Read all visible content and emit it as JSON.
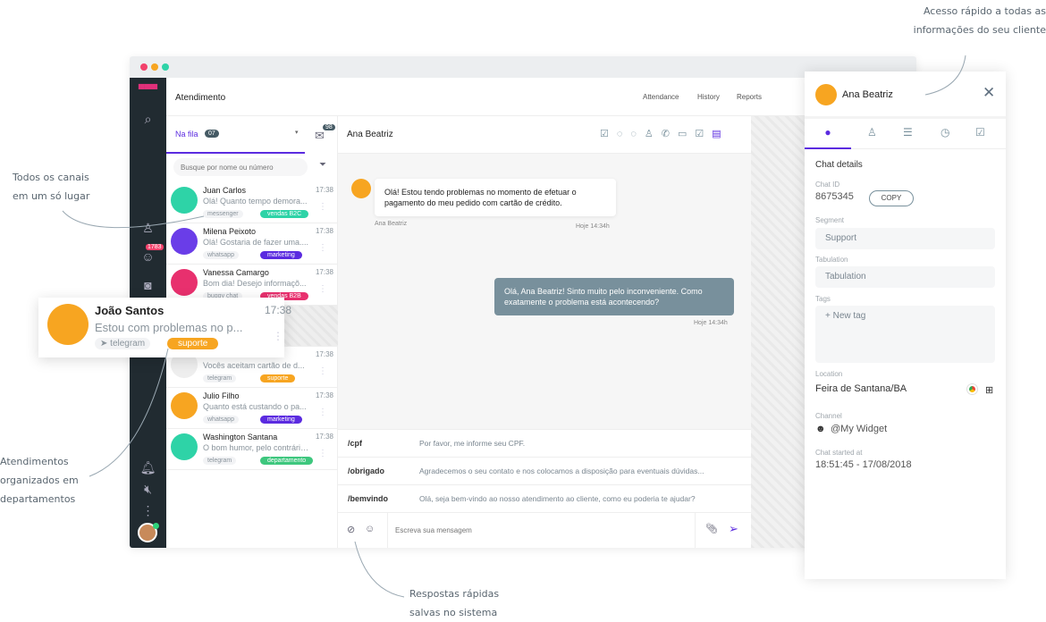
{
  "annotations": [
    "Acesso rápido a todas as informações do seu cliente",
    "Todos os canais em um só lugar",
    "Atendimentos organizados em departamentos",
    "Respostas rápidas salvas no sistema"
  ],
  "header": {
    "title": "Atendimento",
    "nav": [
      "Attendance",
      "History",
      "Reports"
    ]
  },
  "sidebar": {
    "badge": "1783"
  },
  "list": {
    "tab": "Na fila",
    "tab_count": "07",
    "inbox_count": "98",
    "search_placeholder": "Busque por nome ou número",
    "items": [
      {
        "name": "Juan Carlos",
        "msg": "Olá! Quanto tempo demora...",
        "time": "17:38",
        "channel": "messenger",
        "tag": "vendas B2C",
        "tag_color": "#2ed3a7",
        "avatar": "#2ed3a7"
      },
      {
        "name": "Milena Peixoto",
        "msg": "Olá! Gostaria de fazer uma....",
        "time": "17:38",
        "channel": "whatsapp",
        "tag": "marketing",
        "tag_color": "#5b2be0",
        "avatar": "#6a3de8"
      },
      {
        "name": "Vanessa Camargo",
        "msg": "Bom dia! Desejo informaçõ...",
        "time": "17:38",
        "channel": "buggy chat",
        "tag": "vendas B2B",
        "tag_color": "#e8306e",
        "avatar": "#e8306e"
      },
      {
        "name": "",
        "msg": "",
        "time": "",
        "channel": "",
        "tag": "",
        "tag_color": "#ddd",
        "avatar": "#ddd"
      },
      {
        "name": "",
        "msg": "Vocês aceitam cartão de d...",
        "time": "17:38",
        "channel": "telegram",
        "tag": "suporte",
        "tag_color": "#f7a521",
        "avatar": "#eee"
      },
      {
        "name": "Julio Filho",
        "msg": "Quanto está custando o pa...",
        "time": "17:38",
        "channel": "whatsapp",
        "tag": "marketing",
        "tag_color": "#5b2be0",
        "avatar": "#f7a521"
      },
      {
        "name": "Washington Santana",
        "msg": "O bom humor, pelo contrário...",
        "time": "17:38",
        "channel": "telegram",
        "tag": "departamento",
        "tag_color": "#3ec77e",
        "avatar": "#2ed3a7"
      }
    ]
  },
  "floating_card": {
    "name": "João Santos",
    "msg": "Estou com problemas no p...",
    "time": "17:38",
    "channel": "telegram",
    "tag": "suporte"
  },
  "chat": {
    "contact": "Ana Beatriz",
    "incoming": {
      "text": "Olá! Estou tendo problemas no momento de efetuar o pagamento do meu pedido com cartão de crédito.",
      "author": "Ana Beatriz",
      "time": "Hoje 14:34h"
    },
    "outgoing": {
      "text": "Olá, Ana Beatriz! Sinto muito pelo inconveniente. Como exatamente o problema está acontecendo?",
      "time": "Hoje 14:34h"
    },
    "quick_replies": [
      {
        "cmd": "/cpf",
        "text": "Por favor, me informe seu CPF."
      },
      {
        "cmd": "/obrigado",
        "text": "Agradecemos o seu contato e nos colocamos a disposição para eventuais dúvidas..."
      },
      {
        "cmd": "/bemvindo",
        "text": "Olá, seja bem-vindo ao nosso atendimento ao cliente, como eu poderia te ajudar?"
      }
    ],
    "input_placeholder": "Escreva sua mensagem"
  },
  "panel": {
    "name": "Ana Beatriz",
    "section": "Chat details",
    "chat_id_label": "Chat ID",
    "chat_id": "8675345",
    "copy": "COPY",
    "segment_label": "Segment",
    "segment": "Support",
    "tabulation_label": "Tabulation",
    "tabulation": "Tabulation",
    "tags_label": "Tags",
    "new_tag": "+ New tag",
    "location_label": "Location",
    "location": "Feira de Santana/BA",
    "channel_label": "Channel",
    "channel": "@My Widget",
    "started_label": "Chat started at",
    "started": "18:51:45 - 17/08/2018"
  },
  "colors": {
    "accent": "#5b2be0",
    "sidebar": "#212b31",
    "bubble_out": "#78909c"
  }
}
